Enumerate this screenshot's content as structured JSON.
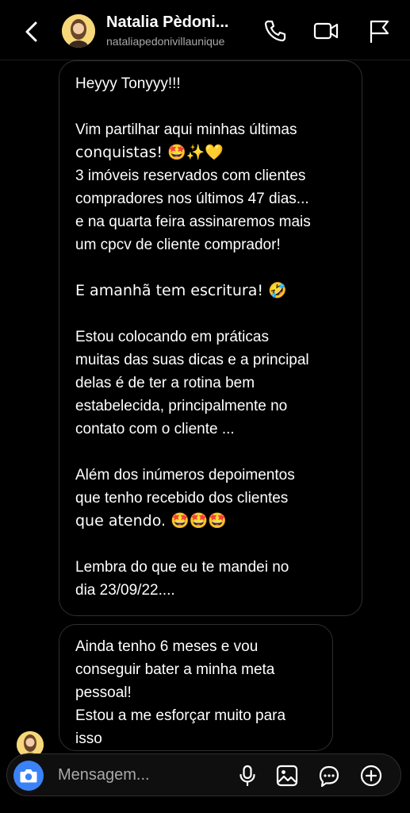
{
  "header": {
    "title": "Natalia Pèdoni...",
    "subtitle": "nataliapedonivillaunique",
    "icons": [
      "back-icon",
      "phone-icon",
      "video-icon",
      "flag-icon"
    ]
  },
  "messages": [
    {
      "lines": [
        "Heyyy Tonyyy!!!",
        "",
        "Vim partilhar aqui minhas últimas",
        "conquistas! 🤩✨💛",
        "3 imóveis reservados com clientes",
        "compradores nos últimos 47 dias...",
        "e na quarta feira assinaremos mais",
        "um cpcv de cliente comprador!",
        "",
        "E amanhã tem escritura! 🤣",
        "",
        "Estou colocando em práticas",
        "muitas das suas dicas e a principal",
        "delas é de ter a rotina bem",
        "estabelecida, principalmente no",
        "contato com o cliente ...",
        "",
        "Além dos inúmeros depoimentos",
        "que tenho recebido dos clientes",
        "que atendo. 🤩🤩🤩",
        "",
        "Lembra do que eu te mandei no",
        "dia 23/09/22...."
      ]
    },
    {
      "lines": [
        "Ainda tenho 6 meses e vou",
        "conseguir bater a minha meta",
        "pessoal!",
        "Estou a me esforçar muito para",
        "isso"
      ]
    }
  ],
  "composer": {
    "placeholder": "Mensagem...",
    "icons": [
      "camera-icon",
      "microphone-icon",
      "image-icon",
      "sticker-icon",
      "plus-icon"
    ]
  },
  "colors": {
    "background": "#000000",
    "bubble_border": "#2f2f2f",
    "secondary_text": "#a8a8a8",
    "camera_button": "#3b82f6",
    "avatar": "#f6d77a"
  }
}
